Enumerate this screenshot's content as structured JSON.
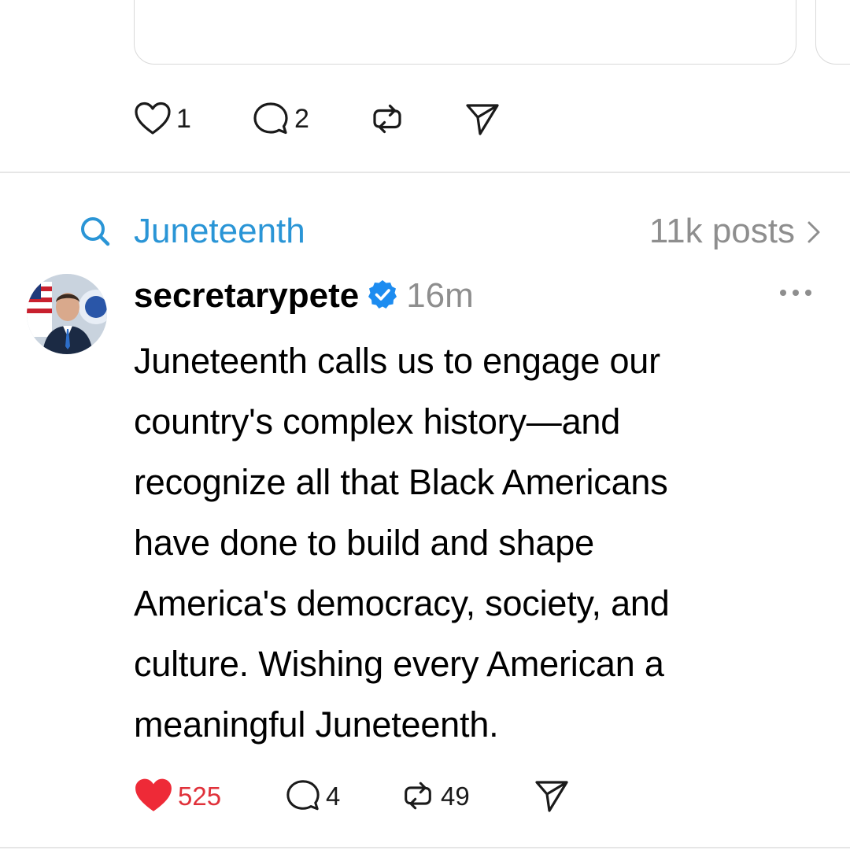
{
  "previous_post": {
    "like_count": "1",
    "reply_count": "2"
  },
  "topic": {
    "icon": "search-icon",
    "label": "Juneteenth",
    "posts_count": "11k posts",
    "color": "#2a95d6"
  },
  "post": {
    "username": "secretarypete",
    "verified": true,
    "time": "16m",
    "text": "Juneteenth calls us to engage our\ncountry's complex history—and\nrecognize all that Black Americans\nhave done to build and shape\nAmerica's democracy, society, and\nculture. Wishing every American a\nmeaningful Juneteenth.",
    "like_count": "525",
    "liked": true,
    "reply_count": "4",
    "repost_count": "49",
    "like_color": "#ee2a37",
    "verified_color": "#1d8cf0"
  }
}
